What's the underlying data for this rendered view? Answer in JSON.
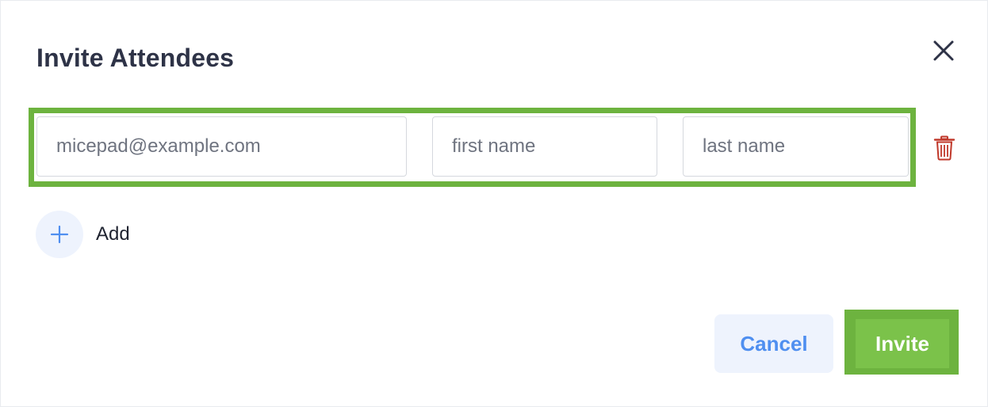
{
  "dialog": {
    "title": "Invite Attendees",
    "close_icon": "close-icon"
  },
  "attendee_row": {
    "email": {
      "value": "",
      "placeholder": "micepad@example.com"
    },
    "first_name": {
      "value": "",
      "placeholder": "first name"
    },
    "last_name": {
      "value": "",
      "placeholder": "last name"
    },
    "delete_icon": "trash-icon"
  },
  "add": {
    "label": "Add",
    "icon": "plus-icon"
  },
  "footer": {
    "cancel_label": "Cancel",
    "invite_label": "Invite"
  },
  "colors": {
    "highlight": "#6db33f",
    "invite_bg": "#7bc24a",
    "accent_blue": "#4f8ff0",
    "light_blue_bg": "#eef3fd",
    "delete_red": "#c0392b",
    "title_text": "#2e3347"
  }
}
